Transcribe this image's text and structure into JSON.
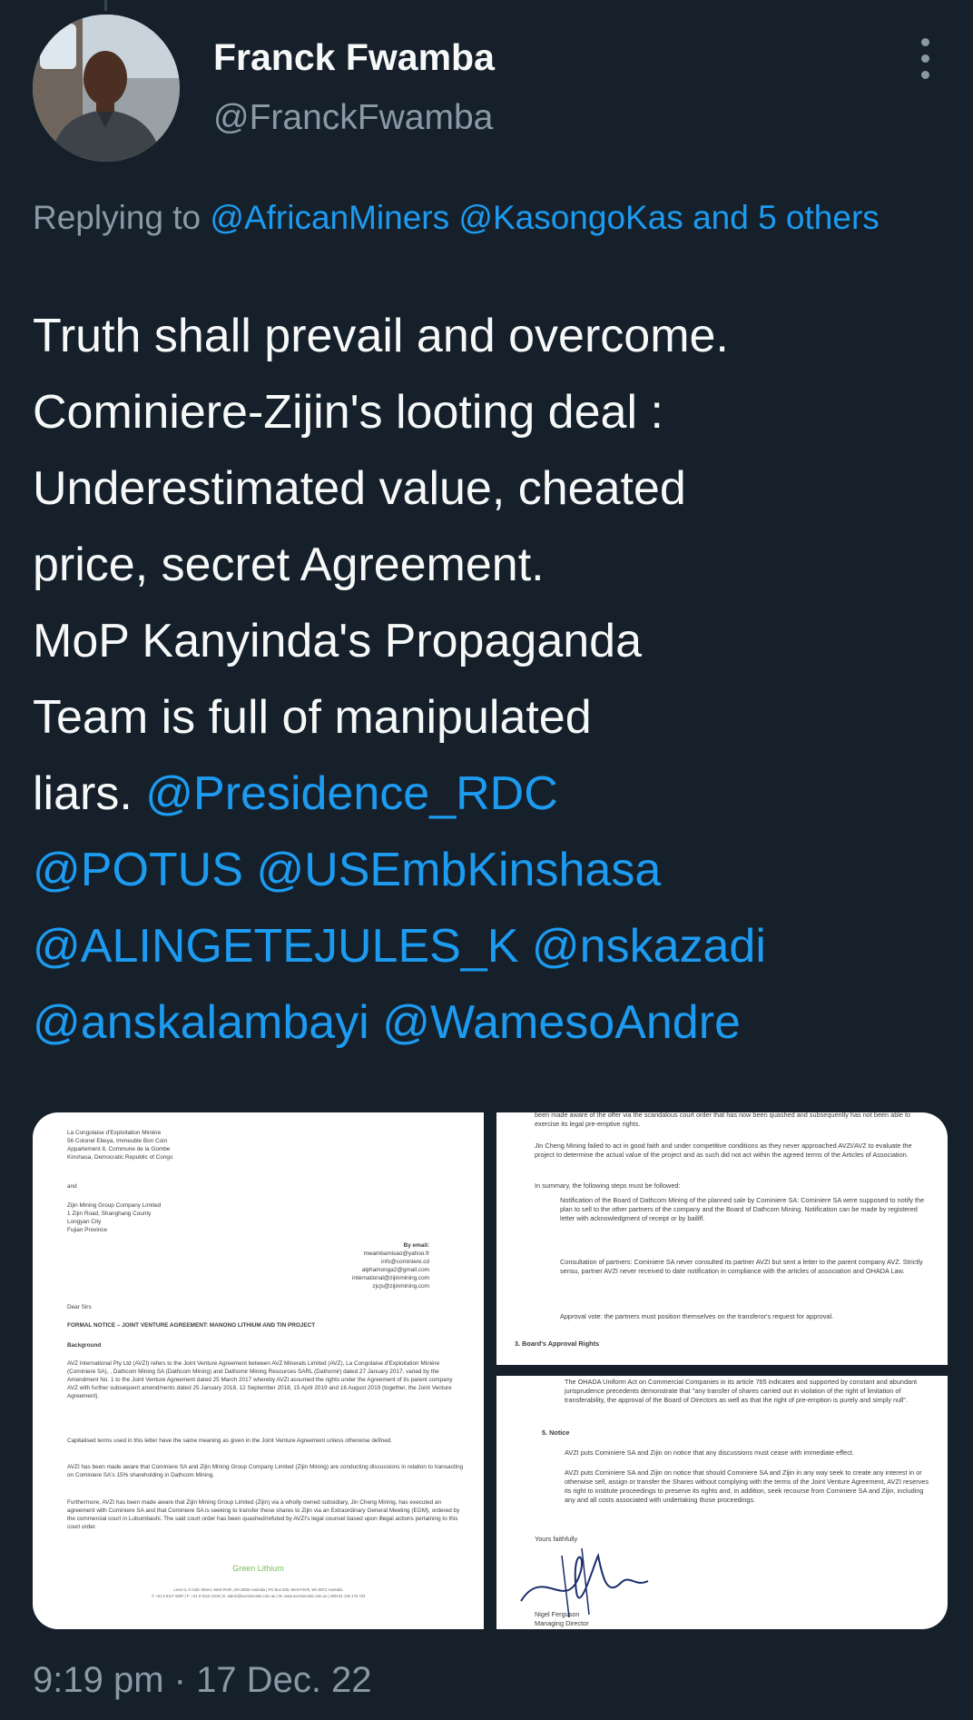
{
  "author": {
    "name": "Franck Fwamba",
    "handle": "@FranckFwamba"
  },
  "reply": {
    "prefix": "Replying to ",
    "mentions": "@AfricanMiners @KasongoKas and 5 others"
  },
  "tweet": {
    "line1": "Truth shall prevail and overcome.",
    "line2": "Cominiere-Zijin's looting deal :",
    "line3": "Underestimated value, cheated",
    "line4": "price, secret Agreement.",
    "line5": "MoP Kanyinda's Propaganda",
    "line6": "Team is full of manipulated",
    "line7_text": "liars. ",
    "mentions": [
      "@Presidence_RDC",
      "@POTUS",
      "@USEmbKinshasa",
      "@ALINGETEJULES_K",
      "@nskazadi",
      "@anskalambayi",
      "@WamesoAndre"
    ]
  },
  "timestamp": "9:19 pm · 17 Dec. 22",
  "doc1": {
    "addr1": [
      "La Congolaise d'Exploitation Minière",
      "56 Colonel Ebeya, Immeuble Bon Coin",
      "Appartement 8, Commune de la Gombe",
      "Kinshasa, Democratic Republic of Congo"
    ],
    "and": "and",
    "addr2": [
      "Zijin Mining Group Company Limited",
      "1 Zijin Road, Shanghang County",
      "Longyan City",
      "Fujian Province"
    ],
    "by_email": "By email:",
    "emails": [
      "mwambamisao@yahoo.fr",
      "info@cominiere.cd",
      "alphamonga2@gmail.com",
      "international@zijinmining.com",
      "zjcjs@zijinmining.com"
    ],
    "salutation": "Dear Sirs",
    "subject": "FORMAL NOTICE – JOINT VENTURE AGREEMENT: MANONO LITHIUM AND TIN PROJECT",
    "background": "Background",
    "para1": "AVZ International Pty Ltd (AVZI) refers to the Joint Venture Agreement between AVZ Minerals Limited (AVZ), La Congolaise d'Exploitation Minière (Cominiere SA), , Dathcom Mining SA (Dathcom Mining) and Dathomir Mining Resources SARL (Dathomir) dated 27 January 2017, varied by the Amendment No. 1 to the Joint Venture Agreement dated 25 March 2017 whereby AVZI assumed the rights under the Agreement of its parent company AVZ with further subsequent amendments dated 25 January 2018, 12 September 2018, 15 April 2019 and 16 August 2019 (together, the Joint Venture Agreement).",
    "para2": "Capitalised terms used in this letter have the same meaning as given in the Joint Venture Agreement unless otherwise defined.",
    "para3": "AVZI has been made aware that Cominiere SA and Zijin Mining Group Company Limited (Zijin Mining) are conducting discussions in relation to transacting on Cominiere SA's 15% shareholding in Dathcom Mining.",
    "para4": "Furthermore, AVZI has been made aware that Zijin Mining Group Limited (Zijin) via a wholly owned subsidiary, Jin Cheng Mining, has executed an agreement with Cominiere SA and that Cominiere SA is seeking to transfer these shares to Zijin via an Extraordinary General Meeting (EGM), ordered by the commercial court in Lubumbashi. The said court order has been quashed/refuted by AVZI's legal counsel based upon illegal actions pertaining to this court order.",
    "logo": "Green Lithium",
    "footer1": "Level 2, 8 Colin Street, West Perth, WA 6005 Australia | PO Box 530, West Perth, WA 6872 Australia",
    "footer2": "T: +61 8 6117 9397 | F: +61 8 6118 2106 | E: admin@avzminerals.com.au | W: www.avzminerals.com.au | ABN 81 125 176 703"
  },
  "doc2": {
    "para1": "been made aware of the offer via the scandalous court order that has now been quashed and subsequently has not been able to exercise its legal pre-emptive rights.",
    "para2": "Jin Cheng Mining failed to act in good faith and under competitive conditions as they never approached AVZI/AVZ to evaluate the project to determine the actual value of the project and as such did not act within the agreed terms of the Articles of Association.",
    "para3": "In summary, the following steps must be followed:",
    "bullet1": "Notification of the Board of Dathcom Mining of the planned sale by Cominiere SA: Cominiere SA were supposed to notify the plan to sell to the other partners of the company and the Board of Dathcom Mining. Notification can be made by registered letter with acknowledgment of receipt or by bailiff.",
    "bullet2": "Consultation of partners: Cominiere SA never consulted its partner AVZI but sent a letter to the parent company AVZ. Strictly sensu, partner AVZI never received to date notification in compliance with the articles of association and OHADA Law.",
    "bullet3": "Approval vote: the partners must position themselves on the transferor's request for approval.",
    "heading": "3.     Board's Approval Rights"
  },
  "doc3": {
    "para1": "The OHADA Uniform Act on Commercial Companies in its article 765 indicates and supported by constant and abundant jurisprudence precedents demonstrate that \"any transfer of shares carried out in violation of the right of limitation of transferability, the approval of the Board of Directors as well as that the right of pre-emption is purely and simply null\".",
    "heading": "5.     Notice",
    "para2": "AVZI puts Cominiere SA and Zijin on notice that any discussions must cease with immediate effect.",
    "para3": "AVZI puts Cominiere SA and Zijin on notice that should Cominiere SA and Zijin in any way seek to create any interest in or otherwise sell, assign or transfer the Shares without complying with the terms of the Joint Venture Agreement, AVZI reserves its right to institute proceedings to preserve its rights and, in addition, seek recourse from Cominiere SA and Zijin, including any and all costs associated with undertaking those proceedings.",
    "closing": "Yours faithfully",
    "signer": "Nigel Ferguson",
    "title": "Managing Director"
  }
}
